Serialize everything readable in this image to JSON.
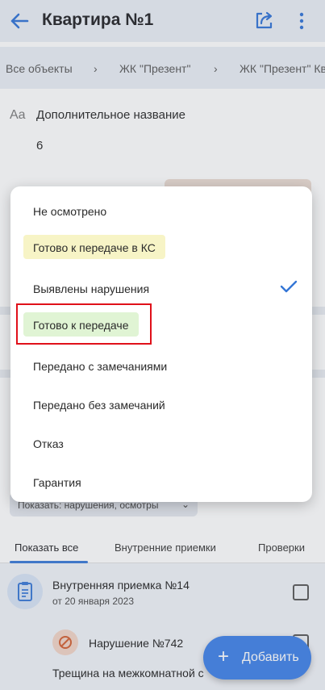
{
  "header": {
    "title": "Квартира №1"
  },
  "breadcrumbs": [
    "Все объекты",
    "ЖК \"Презент\"",
    "ЖК \"Презент\" Кв"
  ],
  "field": {
    "icon_text": "Aa",
    "label": "Дополнительное название",
    "value": "6"
  },
  "filter": {
    "label": "Показать: нарушения, осмотры"
  },
  "tabs": [
    {
      "label": "Показать все"
    },
    {
      "label": "Внутренние приемки"
    },
    {
      "label": "Проверки"
    }
  ],
  "list": {
    "item1": {
      "title": "Внутренняя приемка №14",
      "subtitle": "от 20 января 2023"
    },
    "item2": {
      "title": "Нарушение №742",
      "description": "Трещина на межкомнатной с"
    }
  },
  "fab": {
    "label": "Добавить"
  },
  "status_menu": {
    "options": [
      {
        "label": "Не осмотрено",
        "chip_color": ""
      },
      {
        "label": "Готово к передаче в КС",
        "chip_color": "#f7f4c6"
      },
      {
        "label": "Выявлены нарушения",
        "chip_color": "",
        "selected": true
      },
      {
        "label": "Готово к передаче",
        "chip_color": "#e0f4d4"
      },
      {
        "label": "Передано с замечаниями",
        "chip_color": ""
      },
      {
        "label": "Передано без замечаний",
        "chip_color": ""
      },
      {
        "label": "Отказ",
        "chip_color": ""
      },
      {
        "label": "Гарантия",
        "chip_color": ""
      }
    ]
  },
  "colors": {
    "accent": "#3a7ee8",
    "highlight_border": "#e0101a",
    "check": "#3476d6"
  },
  "icons": {
    "back": "arrow-left-icon",
    "share": "share-icon",
    "more": "more-vert-icon",
    "check": "check-icon",
    "plus": "plus-icon",
    "clipboard": "clipboard-icon",
    "violation": "prohibited-icon"
  }
}
